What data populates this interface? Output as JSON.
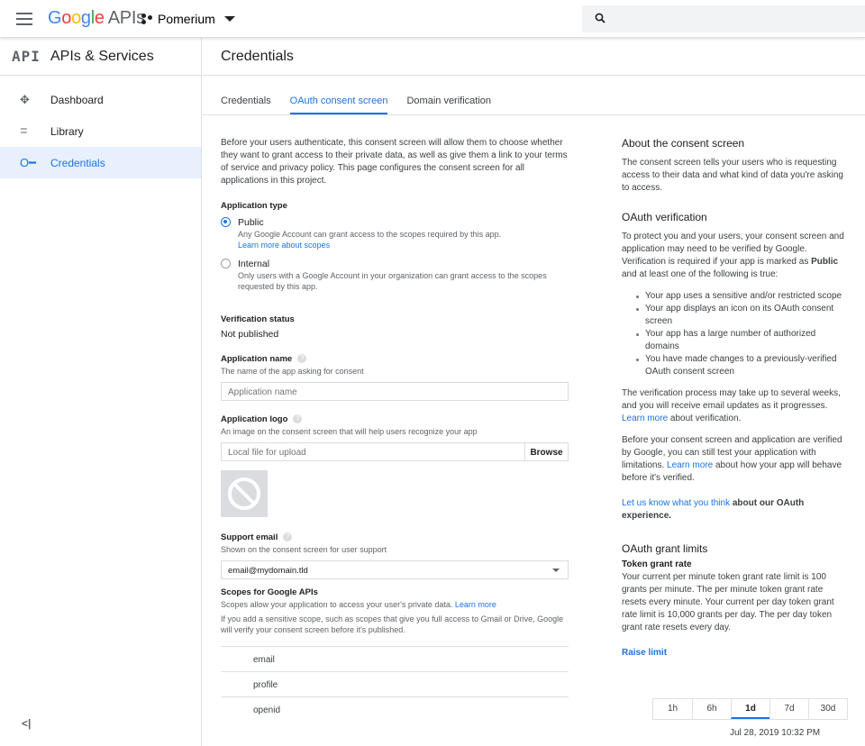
{
  "header": {
    "brand_google": "Google",
    "brand_apis": "APIs",
    "project": "Pomerium",
    "search_placeholder": ""
  },
  "sidebar": {
    "logo": "API",
    "title": "APIs & Services",
    "items": [
      {
        "label": "Dashboard",
        "icon": "dashboard-icon"
      },
      {
        "label": "Library",
        "icon": "library-icon"
      },
      {
        "label": "Credentials",
        "icon": "key-icon",
        "active": true
      }
    ],
    "collapse": "<|"
  },
  "main": {
    "title": "Credentials",
    "tabs": [
      {
        "label": "Credentials"
      },
      {
        "label": "OAuth consent screen",
        "active": true
      },
      {
        "label": "Domain verification"
      }
    ]
  },
  "form": {
    "intro": "Before your users authenticate, this consent screen will allow them to choose whether they want to grant access to their private data, as well as give them a link to your terms of service and privacy policy. This page configures the consent screen for all applications in this project.",
    "app_type_label": "Application type",
    "public_label": "Public",
    "public_hint": "Any Google Account can grant access to the scopes required by this app.",
    "public_link": "Learn more about scopes",
    "internal_label": "Internal",
    "internal_hint": "Only users with a Google Account in your organization can grant access to the scopes requested by this app.",
    "verification_label": "Verification status",
    "verification_value": "Not published",
    "app_name_label": "Application name",
    "app_name_hint": "The name of the app asking for consent",
    "app_name_placeholder": "Application name",
    "app_logo_label": "Application logo",
    "app_logo_hint": "An image on the consent screen that will help users recognize your app",
    "file_placeholder": "Local file for upload",
    "browse": "Browse",
    "support_label": "Support email",
    "support_hint": "Shown on the consent screen for user support",
    "support_value": "email@mydomain.tld",
    "scopes_label": "Scopes for Google APIs",
    "scopes_hint": "Scopes allow your application to access your user's private data.",
    "scopes_link": "Learn more",
    "scopes_note": "If you add a sensitive scope, such as scopes that give you full access to Gmail or Drive, Google will verify your consent screen before it's published.",
    "scopes": [
      "email",
      "profile",
      "openid"
    ]
  },
  "aside": {
    "about_title": "About the consent screen",
    "about_text": "The consent screen tells your users who is requesting access to their data and what kind of data you're asking to access.",
    "verif_title": "OAuth verification",
    "verif_text_a": "To protect you and your users, your consent screen and application may need to be verified by Google. Verification is required if your app is marked as",
    "verif_text_b": "Public",
    "verif_text_c": "and at least one of the following is true:",
    "bullets": [
      "Your app uses a sensitive and/or restricted scope",
      "Your app displays an icon on its OAuth consent screen",
      "Your app has a large number of authorized domains",
      "You have made changes to a previously-verified OAuth consent screen"
    ],
    "process_a": "The verification process may take up to several weeks, and you will receive email updates as it progresses.",
    "process_link": "Learn more",
    "process_b": "about verification.",
    "before_a": "Before your consent screen and application are verified by Google, you can still test your application with limitations.",
    "before_link": "Learn more",
    "before_b": "about how your app will behave before it's verified.",
    "feedback_link": "Let us know what you think",
    "feedback_b": "about our OAuth experience.",
    "limits_title": "OAuth grant limits",
    "token_title": "Token grant rate",
    "token_text": "Your current per minute token grant rate limit is 100 grants per minute. The per minute token grant rate resets every minute. Your current per day token grant rate limit is 10,000 grants per day. The per day token grant rate resets every day.",
    "raise": "Raise limit",
    "ranges": [
      "1h",
      "6h",
      "1d",
      "7d",
      "30d"
    ],
    "selected_range": "1d",
    "date": "Jul 28, 2019 10:32 PM"
  }
}
